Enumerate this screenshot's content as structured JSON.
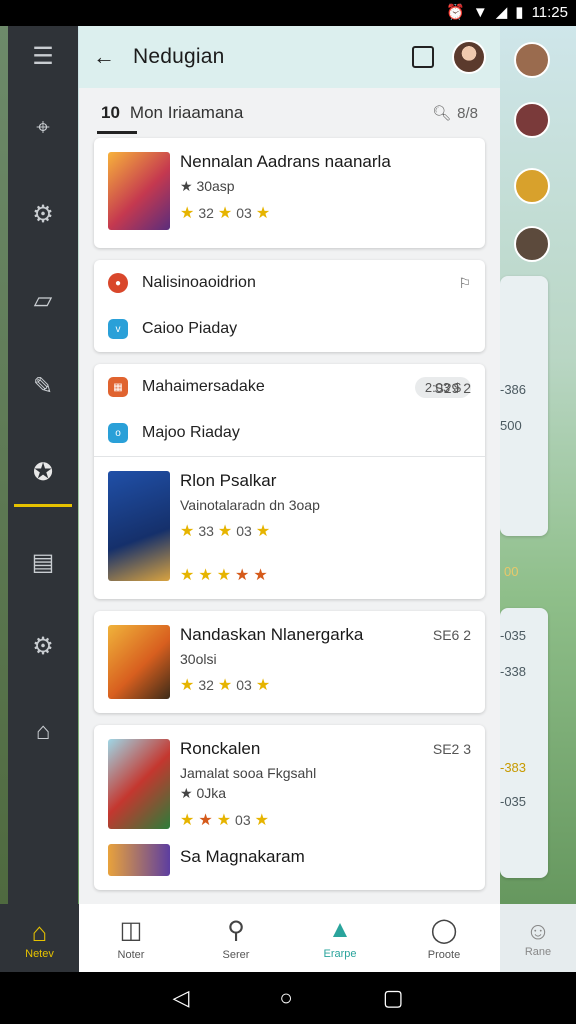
{
  "status": {
    "time": "11:25",
    "icons": [
      "alarm-icon",
      "wifi-icon",
      "signal-icon",
      "battery-icon"
    ]
  },
  "appbar": {
    "title": "Nedugian"
  },
  "filter": {
    "count": "10",
    "label": "Mon Iriaamana",
    "search_label": "8/8"
  },
  "cards": [
    {
      "type": "game",
      "title": "Nennalan Aadrans naanarla",
      "subtitle": "★ 30asp",
      "rating_a": "32",
      "rating_b": "03",
      "price": ""
    },
    {
      "type": "list",
      "rows": [
        {
          "label": "Nalisinoaoidrion",
          "icon": "red"
        },
        {
          "label": "Caioo Piaday",
          "icon": "blue"
        }
      ]
    },
    {
      "type": "list2",
      "rows": [
        {
          "label": "Mahaimersadake",
          "icon": "orange",
          "pill": "2:03 $"
        },
        {
          "label": "Majoo Riaday",
          "icon": "blue"
        }
      ]
    },
    {
      "type": "game",
      "title": "Rlon Psalkar",
      "subtitle": "Vainotalaradn dn 3oap",
      "rating_a": "33",
      "rating_b": "03",
      "price": "S29 2"
    },
    {
      "type": "game",
      "title": "Nandaskan Nlanergarka",
      "subtitle": "30olsi",
      "rating_a": "32",
      "rating_b": "03",
      "price": "SE6 2"
    },
    {
      "type": "game",
      "title": "Ronckalen",
      "subtitle": "Jamalat sooa Fkgsahl",
      "extra": "★ 0Jka",
      "rating_a": "",
      "rating_b": "03",
      "price": "SE2 3"
    },
    {
      "type": "game-min",
      "title": "Sa Magnakaram"
    }
  ],
  "background": {
    "numbers": [
      "-386",
      "500",
      "00",
      "-035",
      "-338",
      "-383",
      "-035"
    ]
  },
  "bottom_nav": [
    {
      "label": "Netev",
      "icon": "home-icon"
    },
    {
      "label": "Noter",
      "icon": "bag-icon"
    },
    {
      "label": "Serer",
      "icon": "search-icon"
    },
    {
      "label": "Erarpe",
      "icon": "alert-icon"
    },
    {
      "label": "Proote",
      "icon": "chat-icon"
    },
    {
      "label": "Rane",
      "icon": "profile-icon"
    }
  ]
}
